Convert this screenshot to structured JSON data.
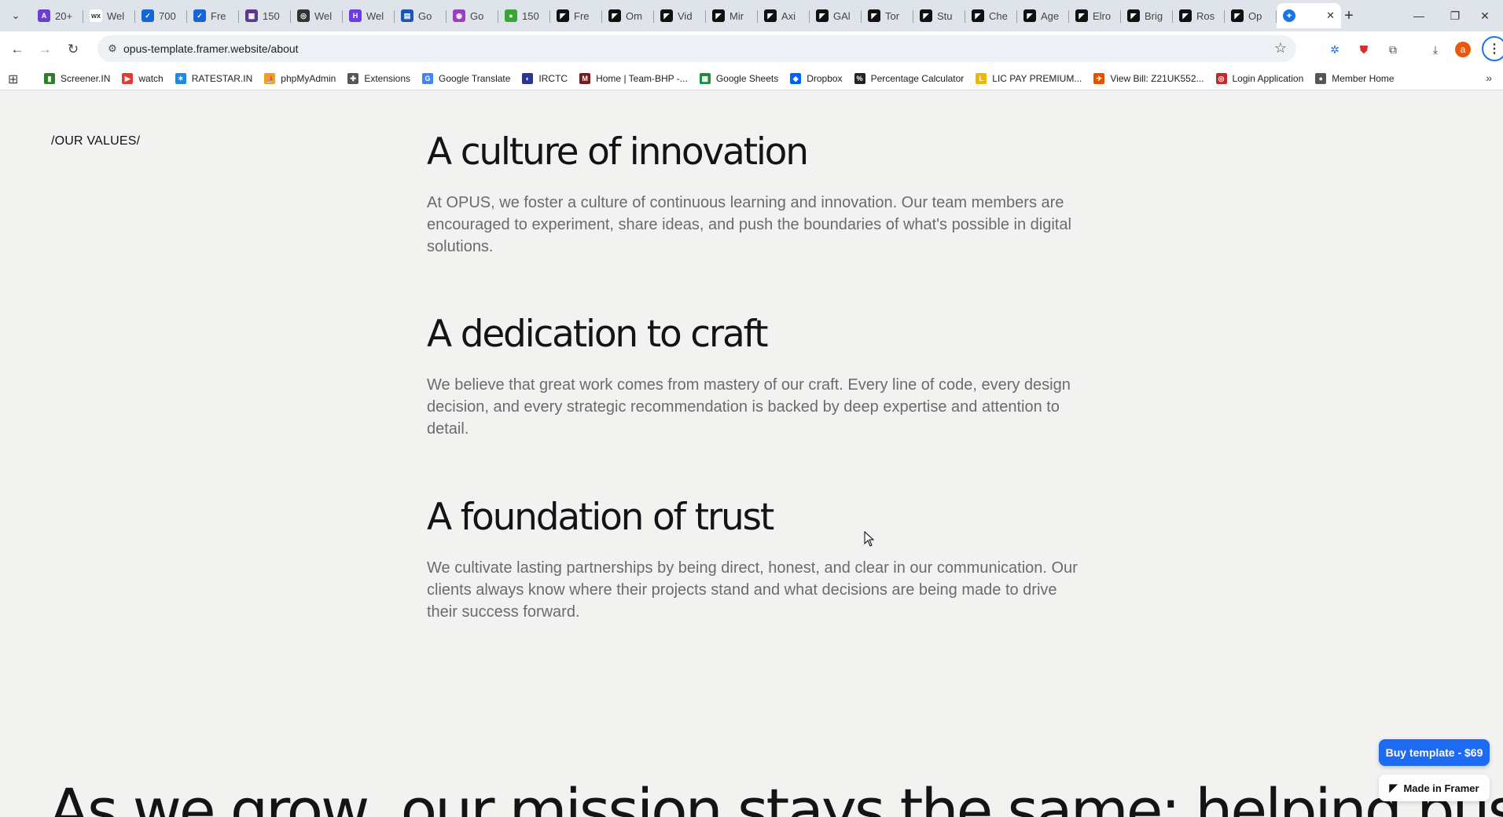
{
  "browser": {
    "tabs": [
      {
        "label": "20+",
        "color": "#6c3fd1",
        "glyph": "A"
      },
      {
        "label": "Wel",
        "color": "#ffffff",
        "glyph": "wx"
      },
      {
        "label": "700",
        "color": "#1565d8",
        "glyph": "✓"
      },
      {
        "label": "Fre",
        "color": "#1565d8",
        "glyph": "✓"
      },
      {
        "label": "150",
        "color": "#5b3a8c",
        "glyph": "▦"
      },
      {
        "label": "Wel",
        "color": "#333333",
        "glyph": "◎"
      },
      {
        "label": "Wel",
        "color": "#6a3de8",
        "glyph": "H"
      },
      {
        "label": "Go",
        "color": "#1a56b8",
        "glyph": "▤"
      },
      {
        "label": "Go",
        "color": "#9c3fbf",
        "glyph": "◉"
      },
      {
        "label": "150",
        "color": "#3aa535",
        "glyph": "●"
      },
      {
        "label": "Fre",
        "color": "#111111",
        "glyph": "◤"
      },
      {
        "label": "Om",
        "color": "#111111",
        "glyph": "◤"
      },
      {
        "label": "Vid",
        "color": "#111111",
        "glyph": "◤"
      },
      {
        "label": "Mir",
        "color": "#111111",
        "glyph": "◤"
      },
      {
        "label": "Axi",
        "color": "#111111",
        "glyph": "◤"
      },
      {
        "label": "GAl",
        "color": "#111111",
        "glyph": "◤"
      },
      {
        "label": "Tor",
        "color": "#111111",
        "glyph": "◤"
      },
      {
        "label": "Stu",
        "color": "#111111",
        "glyph": "◤"
      },
      {
        "label": "Che",
        "color": "#111111",
        "glyph": "◤"
      },
      {
        "label": "Age",
        "color": "#111111",
        "glyph": "◤"
      },
      {
        "label": "Elro",
        "color": "#111111",
        "glyph": "◤"
      },
      {
        "label": "Brig",
        "color": "#111111",
        "glyph": "◤"
      },
      {
        "label": "Ros",
        "color": "#111111",
        "glyph": "◤"
      },
      {
        "label": "Op",
        "color": "#111111",
        "glyph": "◤"
      }
    ],
    "active_tab": {
      "color": "#1a73e8",
      "glyph": "✦"
    },
    "url": "opus-template.framer.website/about",
    "profile_initial": "a",
    "bookmarks": [
      {
        "label": "Screener.IN",
        "color": "#2e7d32",
        "glyph": "▮"
      },
      {
        "label": "watch",
        "color": "#e53935",
        "glyph": "▶"
      },
      {
        "label": "RATESTAR.IN",
        "color": "#1e88e5",
        "glyph": "✶"
      },
      {
        "label": "phpMyAdmin",
        "color": "#f0a020",
        "glyph": "⛵"
      },
      {
        "label": "Extensions",
        "color": "#555555",
        "glyph": "✚"
      },
      {
        "label": "Google Translate",
        "color": "#4285f4",
        "glyph": "G"
      },
      {
        "label": "IRCTC",
        "color": "#283593",
        "glyph": "◐"
      },
      {
        "label": "Home | Team-BHP -...",
        "color": "#7b1a1a",
        "glyph": "M"
      },
      {
        "label": "Google Sheets",
        "color": "#1e8e3e",
        "glyph": "▦"
      },
      {
        "label": "Dropbox",
        "color": "#0061fe",
        "glyph": "◆"
      },
      {
        "label": "Percentage Calculator",
        "color": "#222222",
        "glyph": "%"
      },
      {
        "label": "LIC PAY PREMIUM...",
        "color": "#f2b600",
        "glyph": "L"
      },
      {
        "label": "View Bill: Z21UK552...",
        "color": "#e65100",
        "glyph": "✈"
      },
      {
        "label": "Login Application",
        "color": "#c62828",
        "glyph": "◎"
      },
      {
        "label": "Member Home",
        "color": "#555555",
        "glyph": "●"
      }
    ]
  },
  "page": {
    "section_label": "/OUR VALUES/",
    "values": [
      {
        "title": "A culture of innovation",
        "body": "At OPUS, we foster a culture of continuous learning and innovation. Our team members are encouraged to experiment, share ideas, and push the boundaries of what's possible in digital solutions."
      },
      {
        "title": "A dedication to craft",
        "body": "We believe that great work comes from mastery of our craft. Every line of code, every design decision, and every strategic recommendation is backed by deep expertise and attention to detail."
      },
      {
        "title": "A foundation of trust",
        "body": "We cultivate lasting partnerships by being direct, honest, and clear in our communication. Our clients always know where their projects stand and what decisions are being made to drive their success forward."
      }
    ],
    "mission_heading": "As we grow, our mission stays the same: helping businesses",
    "buy_button": "Buy template - $69",
    "framer_badge": "Made in Framer"
  }
}
